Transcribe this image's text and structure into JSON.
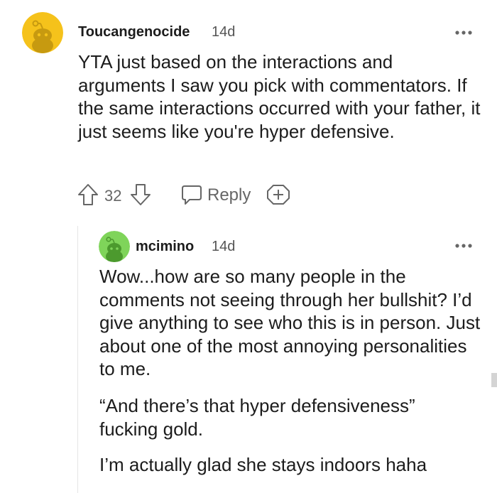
{
  "colors": {
    "avatar_yellow": "#f5c21b",
    "avatar_green": "#7fd45a",
    "text": "#1c1c1c",
    "muted": "#666666"
  },
  "comments": [
    {
      "username": "Toucangenocide",
      "time": "14d",
      "body": "YTA just based on the interactions and arguments I saw you pick with commentators. If the same interactions occurred with your father, it just seems like you're hyper defensive.",
      "score": "32",
      "reply_label": "Reply",
      "icons": [
        "upvote-icon",
        "downvote-icon",
        "reply-bubble-icon",
        "award-icon",
        "more-options-icon"
      ]
    },
    {
      "username": "mcimino",
      "time": "14d",
      "paragraphs": [
        "Wow...how are so many people in the comments not seeing through her bullshit? I’d give anything to see who this is in person. Just about one of the most annoying personalities to me.",
        "“And there’s that hyper defensiveness” fucking gold.",
        "I’m actually glad she stays indoors haha"
      ],
      "icons": [
        "more-options-icon"
      ]
    }
  ]
}
